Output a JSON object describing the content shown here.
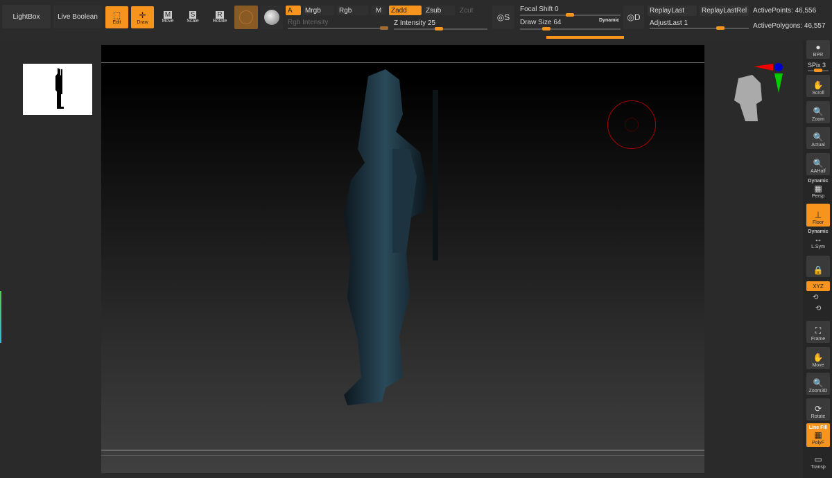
{
  "toolbar": {
    "lightbox": "LightBox",
    "live_boolean": "Live Boolean",
    "edit": "Edit",
    "draw": "Draw",
    "move": "Move",
    "scale": "Scale",
    "rotate": "Rotate",
    "a": "A",
    "mrgb": "Mrgb",
    "rgb": "Rgb",
    "m": "M",
    "zadd": "Zadd",
    "zsub": "Zsub",
    "zcut": "Zcut",
    "rgb_intensity": "Rgb Intensity",
    "z_intensity": "Z Intensity 25",
    "focal_shift": "Focal Shift 0",
    "draw_size": "Draw Size 64",
    "dynamic": "Dynamic",
    "replay_last": "ReplayLast",
    "replay_last_rel": "ReplayLastRel",
    "adjust_last": "AdjustLast 1",
    "active_points": "ActivePoints: 46,556",
    "active_polygons": "ActivePolygons: 46,557",
    "z_intensity_value": 25,
    "focal_shift_value": 0,
    "draw_size_value": 64,
    "adjust_last_value": 1
  },
  "shelf": {
    "bpr": "BPR",
    "spix": "SPix 3",
    "scroll": "Scroll",
    "zoom": "Zoom",
    "actual": "Actual",
    "aahalf": "AAHalf",
    "persp_top": "Dynamic",
    "persp": "Persp",
    "floor": "Floor",
    "lsym_top": "Dynamic",
    "lsym": "L.Sym",
    "xyz": "XYZ",
    "frame": "Frame",
    "move": "Move",
    "zoom3d": "Zoom3D",
    "rotate": "Rotate",
    "polyf_top": "Line Fill",
    "polyf": "PolyF",
    "transp": "Transp"
  },
  "colors": {
    "accent": "#f7941d",
    "background": "#2b2b2b"
  }
}
